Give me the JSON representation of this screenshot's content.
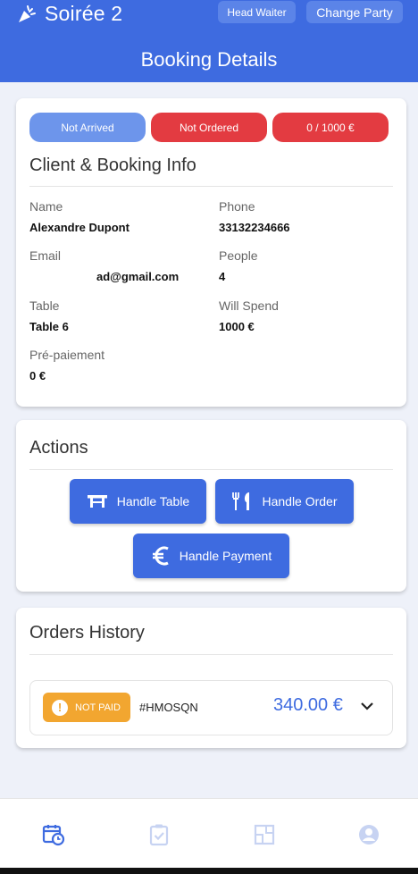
{
  "header": {
    "brand_title": "Soirée 2",
    "head_waiter_label": "Head Waiter",
    "change_party_label": "Change Party",
    "page_title": "Booking Details"
  },
  "status": {
    "arrival": "Not Arrived",
    "order": "Not Ordered",
    "spend_progress": "0 / 1000 €"
  },
  "client_info": {
    "heading": "Client & Booking Info",
    "name_label": "Name",
    "name_value": "Alexandre Dupont",
    "phone_label": "Phone",
    "phone_value": "33132234666",
    "email_label": "Email",
    "email_value": "ad@gmail.com",
    "people_label": "People",
    "people_value": "4",
    "table_label": "Table",
    "table_value": "Table 6",
    "will_spend_label": "Will Spend",
    "will_spend_value": "1000 €",
    "prepayment_label": "Pré-paiement",
    "prepayment_value": "0 €"
  },
  "actions": {
    "heading": "Actions",
    "handle_table": "Handle Table",
    "handle_order": "Handle Order",
    "handle_payment": "Handle Payment"
  },
  "orders": {
    "heading": "Orders History",
    "items": [
      {
        "status": "NOT PAID",
        "code": "#HMOSQN",
        "amount": "340.00 €"
      }
    ]
  },
  "nav": {
    "items": [
      "calendar-clock-icon",
      "clipboard-check-icon",
      "floor-plan-icon",
      "account-icon"
    ],
    "active": "calendar-clock-icon"
  },
  "colors": {
    "primary": "#3e6be0",
    "danger": "#e33b41",
    "warning": "#f2a630",
    "status_blue": "#6d95eb"
  }
}
